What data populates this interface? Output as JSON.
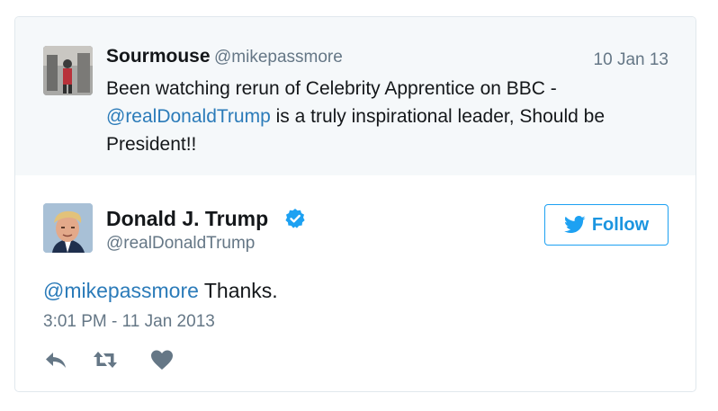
{
  "quoted_tweet": {
    "author_name": "Sourmouse",
    "author_handle": "@mikepassmore",
    "date": "10 Jan 13",
    "text_before": "Been watching rerun of Celebrity Apprentice on BBC -",
    "mention": "@realDonaldTrump",
    "text_after": " is a truly inspirational leader, Should be President!!"
  },
  "main_tweet": {
    "author_name": "Donald J. Trump",
    "author_handle": "@realDonaldTrump",
    "verified_icon": "verified-badge-icon",
    "follow_label": "Follow",
    "mention": "@mikepassmore",
    "text": " Thanks.",
    "timestamp": "3:01 PM - 11 Jan 2013"
  },
  "actions": [
    {
      "icon": "reply-icon"
    },
    {
      "icon": "retweet-icon"
    },
    {
      "icon": "like-icon"
    }
  ],
  "colors": {
    "link": "#2b7bb9",
    "twitter_blue": "#1da1f2",
    "secondary_text": "#657786",
    "quoted_bg": "#f5f8fa",
    "action_gray": "#657786"
  }
}
